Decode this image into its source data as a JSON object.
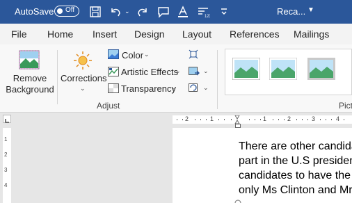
{
  "titlebar": {
    "autosave_label": "AutoSave",
    "toggle_state": "Off",
    "doc_name": "Reca...",
    "qat_icons": [
      "save-icon",
      "undo-icon",
      "redo-icon",
      "comment-icon",
      "font-color-icon",
      "numbering-icon",
      "customize-qat-icon"
    ]
  },
  "tabs": [
    "File",
    "Home",
    "Insert",
    "Design",
    "Layout",
    "References",
    "Mailings"
  ],
  "ribbon": {
    "remove_bg": [
      "Remove",
      "Background"
    ],
    "corrections": "Corrections",
    "color": "Color",
    "artistic": "Artistic Effects",
    "transparency": "Transparency",
    "adjust_label": "Adjust",
    "picture_styles_label": "Pict"
  },
  "ruler": {
    "h_labels": [
      "2",
      "1",
      "1",
      "2",
      "3",
      "4"
    ],
    "v_labels": [
      "1",
      "2",
      "3",
      "4"
    ]
  },
  "document": {
    "lines": [
      "There are other candida",
      "part in the U.S presiden",
      "candidates to have the",
      "only Ms Clinton and Mr"
    ]
  },
  "colors": {
    "accent": "#2b579a"
  }
}
